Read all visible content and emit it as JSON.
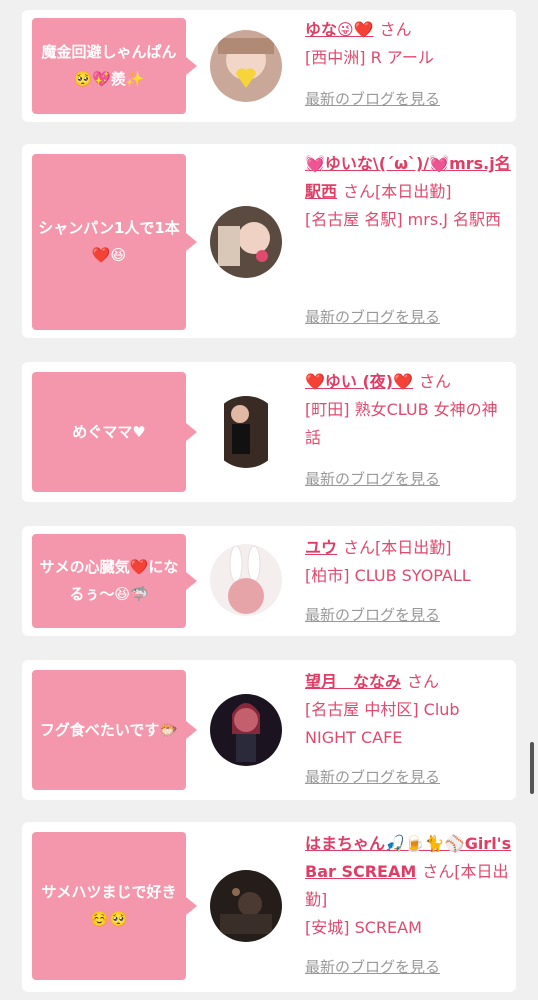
{
  "entries": [
    {
      "message": "魔金回避しゃんぱん🥺💖羨✨",
      "name": "ゆな😜❤️",
      "san": "さん",
      "shop": "[西中洲] R アール",
      "blog": "最新のブログを見る",
      "avatar": "avatar-photo-yuna"
    },
    {
      "message": "シャンパン1人で1本❤️😆",
      "name": "💓ゆいな\\(´ω`)/💓mrs.j名駅西",
      "san": "さん[本日出勤]",
      "shop": "[名古屋 名駅] mrs.J 名駅西",
      "blog": "最新のブログを見る",
      "avatar": "avatar-photo-yuina"
    },
    {
      "message": "めぐママ♥",
      "name": "❤️ゆい (夜)❤️",
      "san": "さん",
      "shop": "[町田] 熟女CLUB 女神の神話",
      "blog": "最新のブログを見る",
      "avatar": "avatar-photo-yui"
    },
    {
      "message": "サメの心臓気❤️になるぅ〜😆🦈",
      "name": "ユウ",
      "san": "さん[本日出勤]",
      "shop": "[柏市] CLUB SYOPALL",
      "blog": "最新のブログを見る",
      "avatar": "avatar-photo-yu"
    },
    {
      "message": "フグ食べたいです🐡",
      "name": "望月　ななみ",
      "san": "さん",
      "shop": "[名古屋 中村区] Club NIGHT CAFE",
      "blog": "最新のブログを見る",
      "avatar": "avatar-photo-nanami"
    },
    {
      "message": "サメハツまじで好き☺️🥺",
      "name": "はまちゃん🎣🍺🐈⚾️Girl's Bar SCREAM",
      "san": "さん[本日出勤]",
      "shop": "[安城] SCREAM",
      "blog": "最新のブログを見る",
      "avatar": "avatar-photo-hamachan"
    }
  ]
}
